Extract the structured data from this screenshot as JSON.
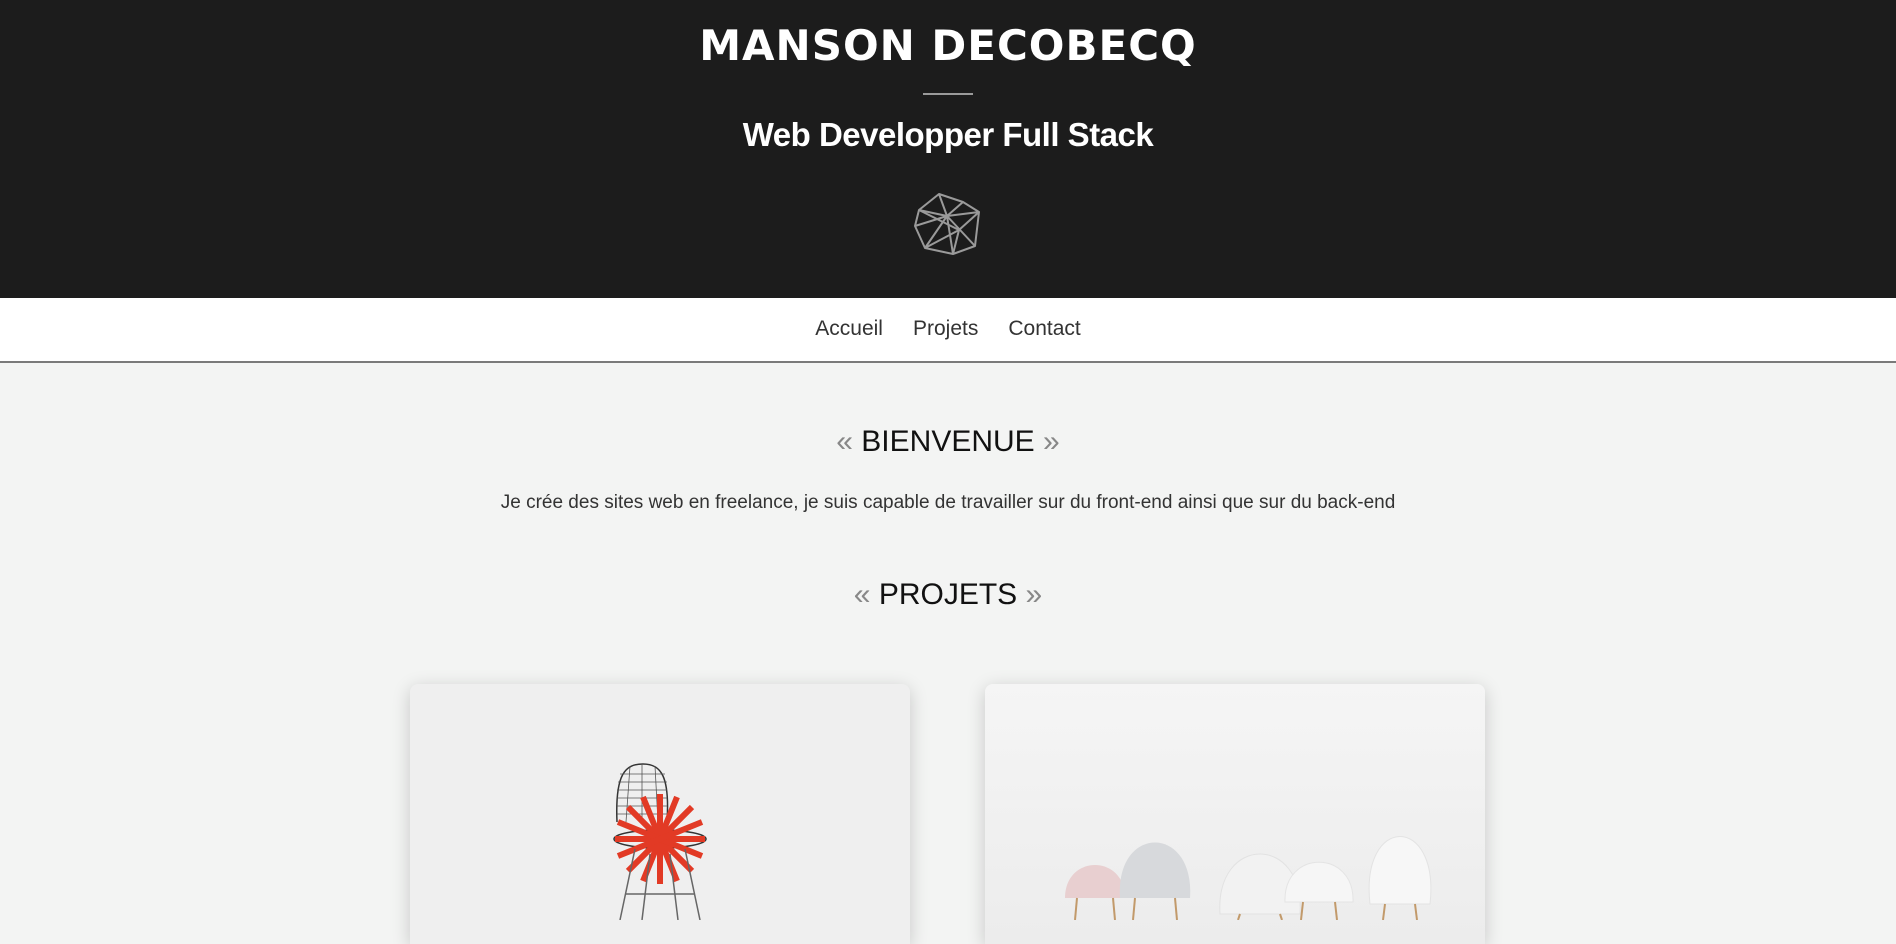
{
  "header": {
    "title": "MANSON DECOBECQ",
    "subtitle": "Web Developper Full Stack",
    "logo_icon": "geometric-polyhedron-logo"
  },
  "nav": {
    "items": [
      {
        "label": "Accueil"
      },
      {
        "label": "Projets"
      },
      {
        "label": "Contact"
      }
    ]
  },
  "welcome": {
    "open_quote": "«",
    "title": "BIENVENUE",
    "close_quote": "»",
    "text": "Je crée des sites web en freelance, je suis capable de travailler sur du front-end ainsi que sur du back-end"
  },
  "projects": {
    "open_quote": "«",
    "title": "PROJETS",
    "close_quote": "»",
    "cards": [
      {
        "image": "wire-chair-with-red-radial-lines"
      },
      {
        "image": "mushroom-shaped-lamps"
      }
    ]
  },
  "colors": {
    "header_bg": "#1c1c1c",
    "page_bg": "#f3f4f3",
    "accent_red": "#e23a25"
  }
}
